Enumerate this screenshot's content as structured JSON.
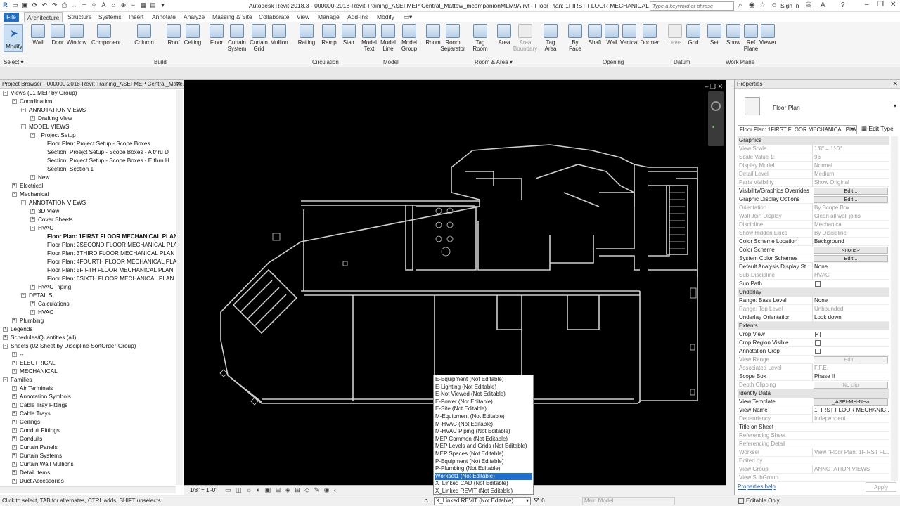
{
  "app": {
    "title": "Autodesk Revit 2018.3 -    000000-2018-Revit Training_ASEI MEP Central_Mattew_mcompanionMLM9A.rvt - Floor Plan: 1FIRST FLOOR MECHANICAL PLAN",
    "search_placeholder": "Type a keyword or phrase",
    "sign_in": "Sign In"
  },
  "menu": {
    "file": "File",
    "tabs": [
      "Architecture",
      "Structure",
      "Systems",
      "Insert",
      "Annotate",
      "Analyze",
      "Massing & Site",
      "Collaborate",
      "View",
      "Manage",
      "Add-Ins",
      "Modify"
    ]
  },
  "ribbon": {
    "modify": "Modify",
    "select": "Select",
    "buttons": [
      {
        "label": "Wall"
      },
      {
        "label": "Door"
      },
      {
        "label": "Window"
      },
      {
        "label": "Component"
      },
      {
        "label": "Column"
      },
      {
        "label": "Roof"
      },
      {
        "label": "Ceiling"
      },
      {
        "label": "Floor"
      },
      {
        "label": "Curtain\nSystem"
      },
      {
        "label": "Curtain\nGrid"
      },
      {
        "label": "Mullion"
      },
      {
        "label": "Railing"
      },
      {
        "label": "Ramp"
      },
      {
        "label": "Stair"
      },
      {
        "label": "Model\nText"
      },
      {
        "label": "Model\nLine"
      },
      {
        "label": "Model\nGroup"
      },
      {
        "label": "Room"
      },
      {
        "label": "Room\nSeparator"
      },
      {
        "label": "Tag\nRoom"
      },
      {
        "label": "Area"
      },
      {
        "label": "Area\nBoundary"
      },
      {
        "label": "Tag\nArea"
      },
      {
        "label": "By\nFace"
      },
      {
        "label": "Shaft"
      },
      {
        "label": "Wall"
      },
      {
        "label": "Vertical"
      },
      {
        "label": "Dormer"
      },
      {
        "label": "Level"
      },
      {
        "label": "Grid"
      },
      {
        "label": "Set"
      },
      {
        "label": "Show"
      },
      {
        "label": "Ref\nPlane"
      },
      {
        "label": "Viewer"
      }
    ],
    "groups": [
      "Build",
      "Circulation",
      "Model",
      "Room & Area",
      "Opening",
      "Datum",
      "Work Plane"
    ]
  },
  "project_browser": {
    "title": "Project Browser - 000000-2018-Revit Training_ASEI MEP Central_Matte...",
    "items": [
      {
        "label": "Views (01 MEP by Group)",
        "toggle": "-"
      },
      {
        "label": "Coordination",
        "toggle": "-"
      },
      {
        "label": "ANNOTATION VIEWS",
        "toggle": "-"
      },
      {
        "label": "Drafting View",
        "toggle": "+"
      },
      {
        "label": "MODEL VIEWS",
        "toggle": "-"
      },
      {
        "label": "_Project Setup",
        "toggle": "-"
      },
      {
        "label": "Floor Plan: Project Setup - Scope Boxes",
        "toggle": ""
      },
      {
        "label": "Section: Proejct Setup - Scope Boxes - A thru D",
        "toggle": ""
      },
      {
        "label": "Section: Project Setup - Scope Boxes - E thru H",
        "toggle": ""
      },
      {
        "label": "Section: Section 1",
        "toggle": ""
      },
      {
        "label": "New",
        "toggle": "+"
      },
      {
        "label": "Electrical",
        "toggle": "+"
      },
      {
        "label": "Mechanical",
        "toggle": "-"
      },
      {
        "label": "ANNOTATION VIEWS",
        "toggle": "-"
      },
      {
        "label": "3D View",
        "toggle": "+"
      },
      {
        "label": "Cover Sheets",
        "toggle": "+"
      },
      {
        "label": "HVAC",
        "toggle": "-"
      },
      {
        "label": "Floor Plan: 1FIRST FLOOR MECHANICAL PLAN",
        "toggle": ""
      },
      {
        "label": "Floor Plan: 2SECOND FLOOR MECHANICAL PLAN",
        "toggle": ""
      },
      {
        "label": "Floor Plan: 3THIRD FLOOR MECHANICAL PLAN",
        "toggle": ""
      },
      {
        "label": "Floor Plan: 4FOURTH FLOOR MECHANICAL PLAN",
        "toggle": ""
      },
      {
        "label": "Floor Plan: 5FIFTH FLOOR MECHANICAL PLAN",
        "toggle": ""
      },
      {
        "label": "Floor Plan: 6SIXTH FLOOR MECHANICAL PLAN",
        "toggle": ""
      },
      {
        "label": "HVAC Piping",
        "toggle": "+"
      },
      {
        "label": "DETAILS",
        "toggle": "-"
      },
      {
        "label": "Calculations",
        "toggle": "+"
      },
      {
        "label": "HVAC",
        "toggle": "+"
      },
      {
        "label": "Plumbing",
        "toggle": "+"
      },
      {
        "label": "Legends",
        "toggle": "+"
      },
      {
        "label": "Schedules/Quantities (all)",
        "toggle": "+"
      },
      {
        "label": "Sheets (02 Sheet by Discipline-SortOrder-Group)",
        "toggle": "-"
      },
      {
        "label": "--",
        "toggle": "+"
      },
      {
        "label": "ELECTRICAL",
        "toggle": "+"
      },
      {
        "label": "MECHANICAL",
        "toggle": "+"
      },
      {
        "label": "Families",
        "toggle": "-"
      },
      {
        "label": "Air Terminals",
        "toggle": "+"
      },
      {
        "label": "Annotation Symbols",
        "toggle": "+"
      },
      {
        "label": "Cable Tray Fittings",
        "toggle": "+"
      },
      {
        "label": "Cable Trays",
        "toggle": "+"
      },
      {
        "label": "Ceilings",
        "toggle": "+"
      },
      {
        "label": "Conduit Fittings",
        "toggle": "+"
      },
      {
        "label": "Conduits",
        "toggle": "+"
      },
      {
        "label": "Curtain Panels",
        "toggle": "+"
      },
      {
        "label": "Curtain Systems",
        "toggle": "+"
      },
      {
        "label": "Curtain Wall Mullions",
        "toggle": "+"
      },
      {
        "label": "Detail Items",
        "toggle": "+"
      },
      {
        "label": "Duct Accessories",
        "toggle": "+"
      }
    ]
  },
  "view_control": {
    "scale": "1/8\" = 1'-0\""
  },
  "workset_dropdown": {
    "options": [
      "E-Equipment (Not Editable)",
      "E-Lighting (Not Editable)",
      "E-Not Viewed (Not Editable)",
      "E-Power (Not Editable)",
      "E-Site (Not Editable)",
      "M-Equipment (Not Editable)",
      "M-HVAC (Not Editable)",
      "M-HVAC Piping (Not Editable)",
      "MEP Common (Not Editable)",
      "MEP Levels and Grids (Not Editable)",
      "MEP Spaces (Not Editable)",
      "P-Equipment (Not Editable)",
      "P-Plumbing (Not Editable)",
      "Workset1 (Not Editable)",
      "X_Linked CAD (Not Editable)",
      "X_Linked REVIT (Not Editable)"
    ],
    "highlighted": "Workset1 (Not Editable)"
  },
  "properties": {
    "title": "Properties",
    "type_name": "Floor Plan",
    "instance_selector": "Floor Plan: 1FIRST FLOOR MECHANICAL PLAN",
    "edit_type": "Edit Type",
    "rows": [
      {
        "kind": "section",
        "label": "Graphics"
      },
      {
        "kind": "row",
        "k": "View Scale",
        "v": "1/8\" = 1'-0\"",
        "dim": true
      },
      {
        "kind": "row",
        "k": "Scale Value    1:",
        "v": "96",
        "dim": true
      },
      {
        "kind": "row",
        "k": "Display Model",
        "v": "Normal",
        "dim": true
      },
      {
        "kind": "row",
        "k": "Detail Level",
        "v": "Medium",
        "dim": true
      },
      {
        "kind": "row",
        "k": "Parts Visibility",
        "v": "Show Original",
        "dim": true
      },
      {
        "kind": "btn",
        "k": "Visibility/Graphics Overrides",
        "v": "Edit..."
      },
      {
        "kind": "btn",
        "k": "Graphic Display Options",
        "v": "Edit..."
      },
      {
        "kind": "row",
        "k": "Orientation",
        "v": "By Scope Box",
        "dim": true
      },
      {
        "kind": "row",
        "k": "Wall Join Display",
        "v": "Clean all wall joins",
        "dim": true
      },
      {
        "kind": "row",
        "k": "Discipline",
        "v": "Mechanical",
        "dim": true
      },
      {
        "kind": "row",
        "k": "Show Hidden Lines",
        "v": "By Discipline",
        "dim": true
      },
      {
        "kind": "row",
        "k": "Color Scheme Location",
        "v": "Background",
        "dim": false
      },
      {
        "kind": "btn",
        "k": "Color Scheme",
        "v": "<none>"
      },
      {
        "kind": "btn",
        "k": "System Color Schemes",
        "v": "Edit..."
      },
      {
        "kind": "row",
        "k": "Default Analysis Display St...",
        "v": "None",
        "dim": false
      },
      {
        "kind": "row",
        "k": "Sub-Discipline",
        "v": "HVAC",
        "dim": true
      },
      {
        "kind": "chk",
        "k": "Sun Path",
        "v": ""
      },
      {
        "kind": "section",
        "label": "Underlay"
      },
      {
        "kind": "row",
        "k": "Range: Base Level",
        "v": "None",
        "dim": false
      },
      {
        "kind": "row",
        "k": "Range: Top Level",
        "v": "Unbounded",
        "dim": true
      },
      {
        "kind": "row",
        "k": "Underlay Orientation",
        "v": "Look down",
        "dim": false
      },
      {
        "kind": "section",
        "label": "Extents"
      },
      {
        "kind": "chk",
        "k": "Crop View",
        "v": "✓"
      },
      {
        "kind": "chk",
        "k": "Crop Region Visible",
        "v": ""
      },
      {
        "kind": "chk",
        "k": "Annotation Crop",
        "v": ""
      },
      {
        "kind": "btn",
        "k": "View Range",
        "v": "Edit...",
        "dim": true
      },
      {
        "kind": "row",
        "k": "Associated Level",
        "v": "F.F.E.",
        "dim": true
      },
      {
        "kind": "row",
        "k": "Scope Box",
        "v": "Phase II",
        "dim": false
      },
      {
        "kind": "btn",
        "k": "Depth Clipping",
        "v": "No clip",
        "dim": true
      },
      {
        "kind": "section",
        "label": "Identity Data"
      },
      {
        "kind": "btn",
        "k": "View Template",
        "v": "_ASEI-MH-New"
      },
      {
        "kind": "row",
        "k": "View Name",
        "v": "1FIRST FLOOR MECHANIC...",
        "dim": false
      },
      {
        "kind": "row",
        "k": "Dependency",
        "v": "Independent",
        "dim": true
      },
      {
        "kind": "row",
        "k": "Title on Sheet",
        "v": "",
        "dim": false
      },
      {
        "kind": "row",
        "k": "Referencing Sheet",
        "v": "",
        "dim": true
      },
      {
        "kind": "row",
        "k": "Referencing Detail",
        "v": "",
        "dim": true
      },
      {
        "kind": "row",
        "k": "Workset",
        "v": "View \"Floor Plan: 1FIRST FL...",
        "dim": true
      },
      {
        "kind": "row",
        "k": "Edited by",
        "v": "",
        "dim": true
      },
      {
        "kind": "row",
        "k": "View Group",
        "v": "ANNOTATION VIEWS",
        "dim": true
      },
      {
        "kind": "row",
        "k": "View SubGroup",
        "v": "",
        "dim": true
      }
    ],
    "help_link": "Properties help",
    "apply": "Apply"
  },
  "status": {
    "message": "Click to select, TAB for alternates, CTRL adds, SHIFT unselects.",
    "workset": "X_Linked REVIT (Not Editable)",
    "zero": ":0",
    "design_option": "Main Model",
    "editable_only": "Editable Only"
  }
}
